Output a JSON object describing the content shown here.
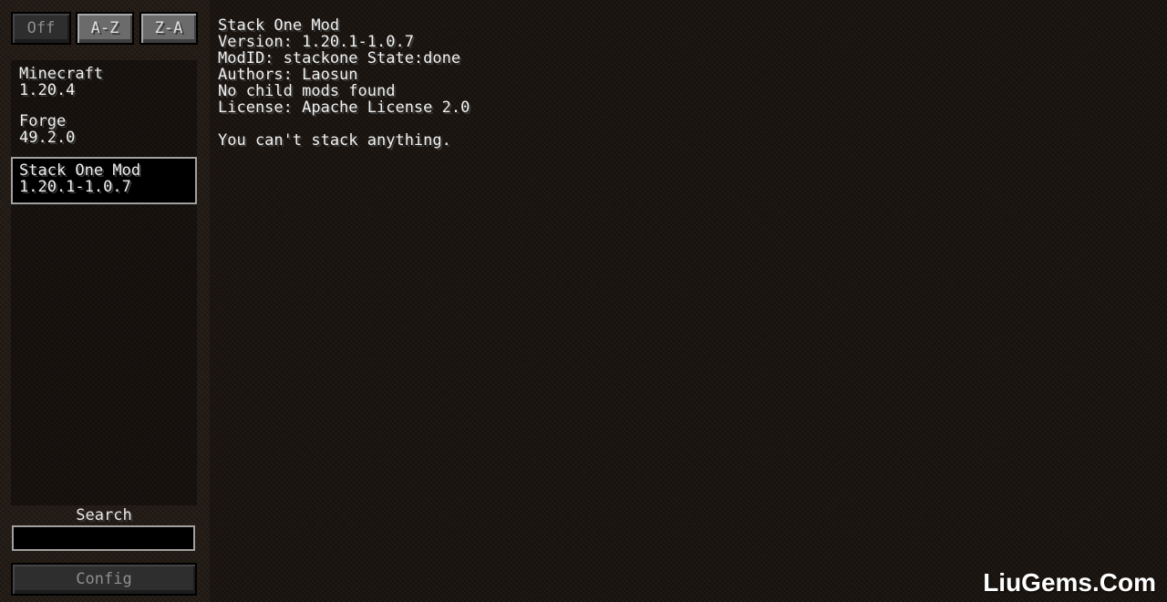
{
  "sort_buttons": {
    "off": "Off",
    "az": "A-Z",
    "za": "Z-A"
  },
  "mod_list": [
    {
      "name": "Minecraft",
      "version": "1.20.4"
    },
    {
      "name": "Forge",
      "version": "49.2.0"
    },
    {
      "name": "Stack One Mod",
      "version": "1.20.1-1.0.7"
    }
  ],
  "search": {
    "label": "Search",
    "value": ""
  },
  "config_button": "Config",
  "details": {
    "name": "Stack One Mod",
    "version": "Version: 1.20.1-1.0.7",
    "modid": "ModID: stackone State:done",
    "authors": "Authors: Laosun",
    "children": "No child mods found",
    "license": "License: Apache License 2.0",
    "description": "You can't stack anything."
  },
  "watermark": "LiuGems.Com",
  "colors": {
    "background": "#231b15",
    "button": "#6b6b6b",
    "selected_border": "#a0a0a0",
    "text": "#f0f0f0"
  }
}
